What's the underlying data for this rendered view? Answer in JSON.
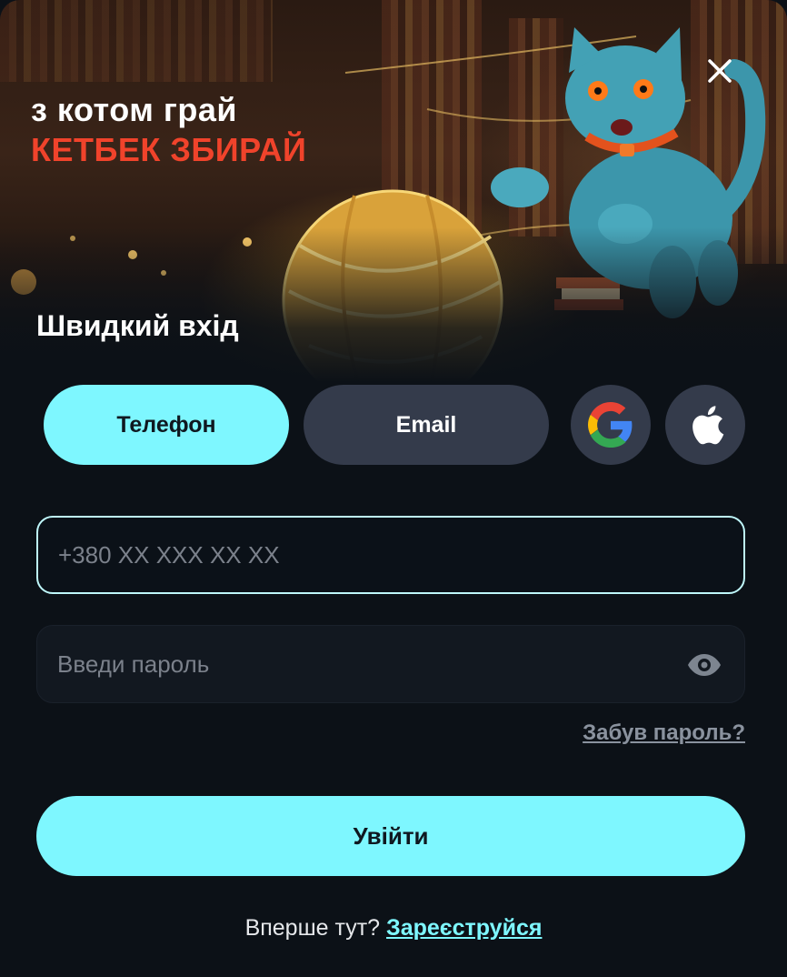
{
  "banner": {
    "promo_line1": "з котом грай",
    "promo_line2": "КЕТБЕК ЗБИРАЙ",
    "accent_color": "#f0432b"
  },
  "title": "Швидкий вхід",
  "tabs": {
    "phone": "Телефон",
    "email": "Email",
    "active": "phone"
  },
  "social": [
    "google-icon",
    "apple-icon"
  ],
  "fields": {
    "phone_placeholder": "+380 XX XXX XX XX",
    "password_placeholder": "Введи пароль"
  },
  "forgot_label": "Забув пароль?",
  "login_label": "Увійти",
  "signup": {
    "prompt": "Вперше тут?",
    "link": "Зареєструйся"
  },
  "colors": {
    "primary": "#7ef7ff",
    "secondary": "#343b4b",
    "background": "#0c1117"
  }
}
